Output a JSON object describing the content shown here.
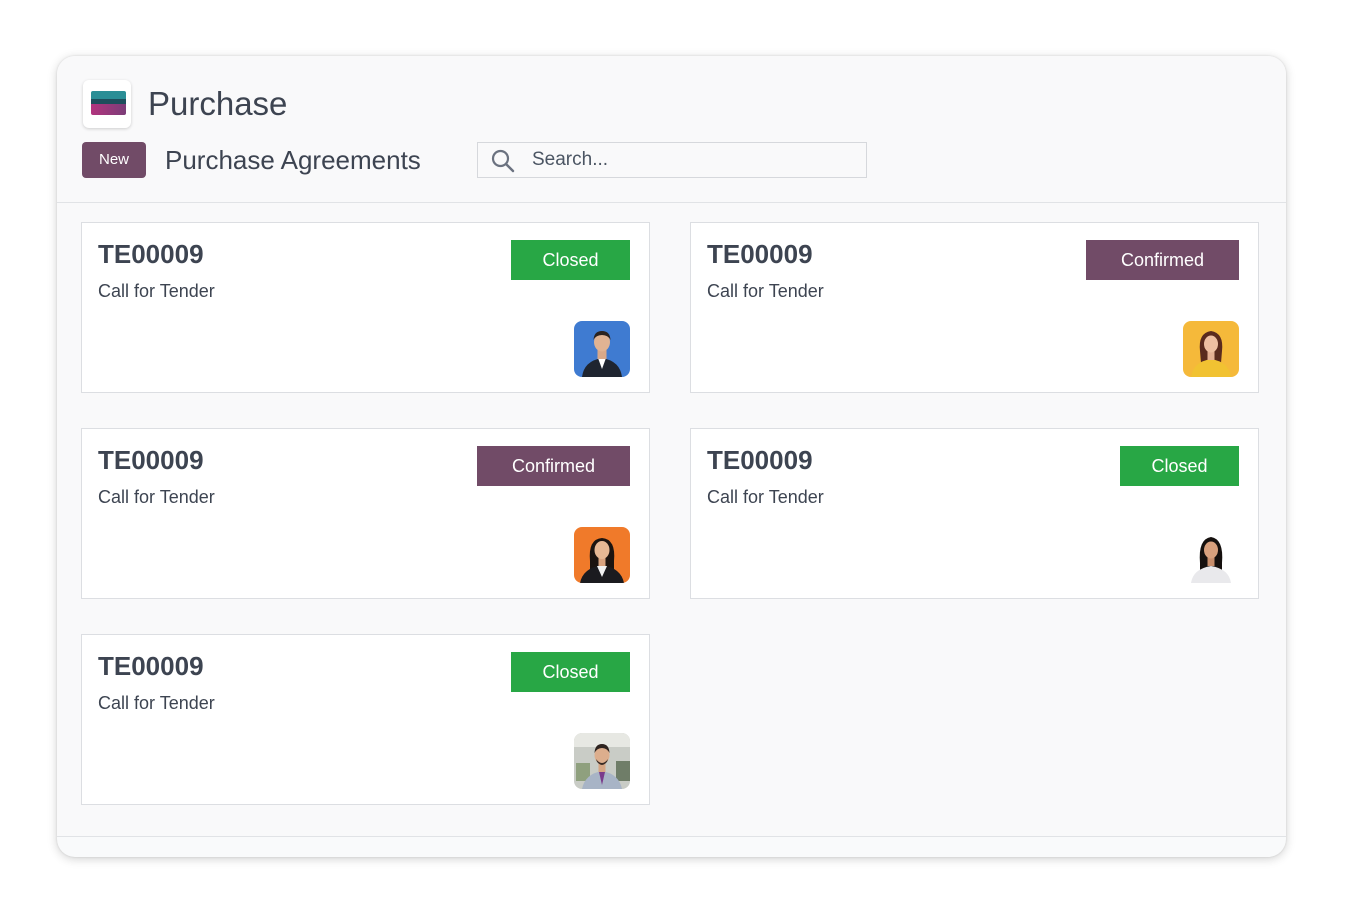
{
  "app": {
    "title": "Purchase",
    "icon": "purchase-app-icon"
  },
  "control_panel": {
    "new_label": "New",
    "page_title": "Purchase Agreements",
    "search": {
      "placeholder": "Search...",
      "value": "",
      "icon": "search-icon"
    }
  },
  "colors": {
    "brand": "#714b67",
    "closed": "#28a745",
    "confirmed": "#714b67"
  },
  "cards": [
    {
      "reference": "TE00009",
      "type": "Call for Tender",
      "status": "Closed",
      "avatar": "avatar-man-suit-blue-bg"
    },
    {
      "reference": "TE00009",
      "type": "Call for Tender",
      "status": "Confirmed",
      "avatar": "avatar-woman-yellow-bg"
    },
    {
      "reference": "TE00009",
      "type": "Call for Tender",
      "status": "Confirmed",
      "avatar": "avatar-woman-orange-bg"
    },
    {
      "reference": "TE00009",
      "type": "Call for Tender",
      "status": "Closed",
      "avatar": "avatar-woman-white-bg"
    },
    {
      "reference": "TE00009",
      "type": "Call for Tender",
      "status": "Closed",
      "avatar": "avatar-man-office-bg"
    }
  ]
}
